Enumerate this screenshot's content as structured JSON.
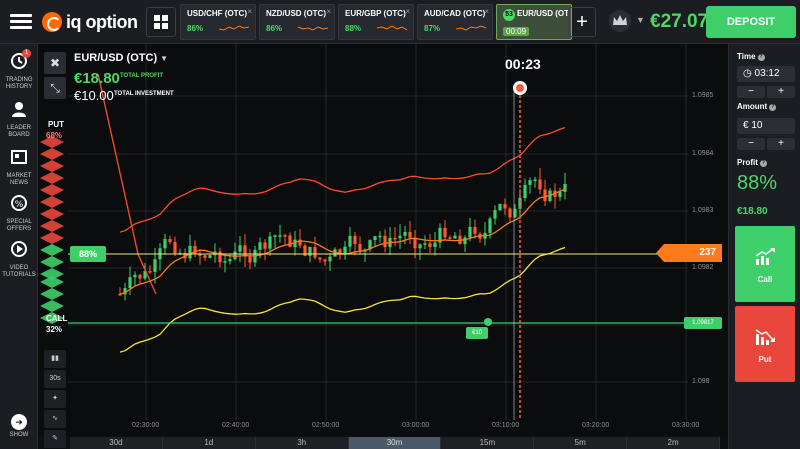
{
  "topbar": {
    "logo_text": "iq option",
    "tabs": [
      {
        "pair": "USD/CHF (OTC)",
        "pct": "86%"
      },
      {
        "pair": "NZD/USD (OTC)",
        "pct": "86%"
      },
      {
        "pair": "EUR/GBP (OTC)",
        "pct": "88%"
      },
      {
        "pair": "AUD/CAD (OTC)",
        "pct": "87%"
      },
      {
        "pair": "EUR/USD (OT",
        "timer": "00:09",
        "badge": "53"
      }
    ],
    "plus_label": "+",
    "balance": "€27.07",
    "deposit_label": "DEPOSIT"
  },
  "sidebar": {
    "items": [
      {
        "label": "TRADING HISTORY",
        "badge": "1"
      },
      {
        "label": "LEADER BOARD"
      },
      {
        "label": "MARKET NEWS"
      },
      {
        "label": "SPECIAL OFFERS"
      },
      {
        "label": "VIDEO TUTORIALS"
      }
    ],
    "show_label": "SHOW"
  },
  "chart_header": {
    "asset": "EUR/USD (OTC)",
    "total_profit_value": "€18.80",
    "total_profit_label": "TOTAL PROFIT",
    "total_investment_value": "€10.00",
    "total_investment_label": "TOTAL INVESTMENT",
    "countdown": "00:23"
  },
  "sentiment": {
    "put_label": "PUT",
    "put_pct": "68%",
    "call_label": "CALL",
    "call_pct": "32%"
  },
  "chart_tags": {
    "level_pct": "88%",
    "current_price": "237",
    "call_price": "1.09817",
    "deal_amount": "€10"
  },
  "axes": {
    "y_labels": [
      "1.0985",
      "1.0984",
      "1.0983",
      "1.0982",
      "1.098"
    ],
    "x_labels": [
      "02:30:00",
      "02:40:00",
      "02:50:00",
      "03:00:00",
      "03:10:00",
      "03:20:00",
      "03:30:00"
    ]
  },
  "bottom_tools": [
    "30s"
  ],
  "timeframes": [
    "30d",
    "1d",
    "3h",
    "30m",
    "15m",
    "5m",
    "2m"
  ],
  "active_timeframe": "30m",
  "right_panel": {
    "time_label": "Time",
    "time_value": "03:12",
    "amount_label": "Amount",
    "amount_value": "€ 10",
    "profit_label": "Profit",
    "profit_pct": "88%",
    "profit_value": "€18.80",
    "call_label": "Call",
    "put_label": "Put"
  },
  "chart_data": {
    "type": "candlestick",
    "y_axis": {
      "min": 1.0979,
      "max": 1.0986
    },
    "bollinger_upper_color": "#ff4a2a",
    "bollinger_lower_color": "#f5e43a",
    "ma_color": "#ff7a1a",
    "up_color": "#3ecf6a",
    "down_color": "#ff5a2a"
  }
}
